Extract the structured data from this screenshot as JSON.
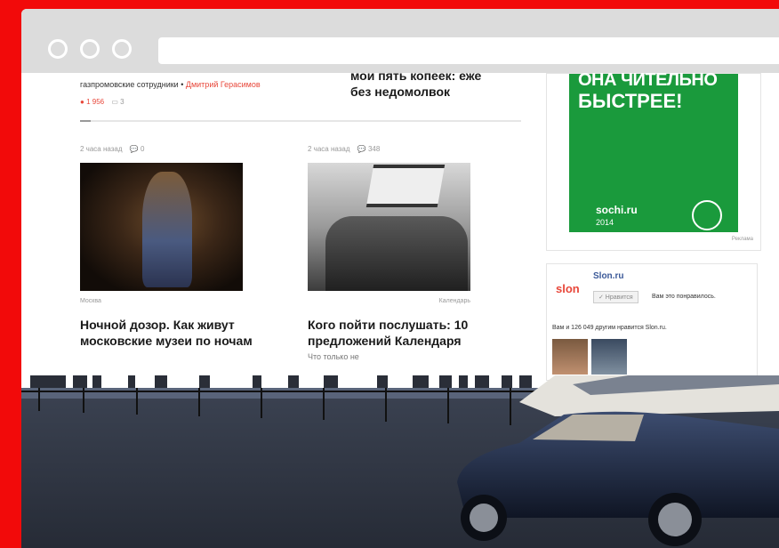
{
  "top_article_left": {
    "byline_prefix": "газпромовские сотрудники •",
    "author": "Дмитрий Герасимов",
    "views": "1 956",
    "comments": "3"
  },
  "top_article_right": {
    "headline_line1": "мои пять копеек: еже",
    "headline_line2": "без недомолвок"
  },
  "cards": [
    {
      "time": "2 часа назад",
      "comments": "0",
      "category": "Москва",
      "headline": "Ночной дозор. Как живут московские музеи по ночам"
    },
    {
      "time": "2 часа назад",
      "comments": "348",
      "category": "Календарь",
      "headline": "Кого пойти послушать: 10 предложений Календаря",
      "teaser": "Что только не"
    }
  ],
  "ad": {
    "line1": "ОНА ЧИТЕЛЬНО",
    "line2": "БЫСТРЕЕ!",
    "brand": "sochi.ru",
    "brand_sub": "2014",
    "label": "Реклама"
  },
  "social": {
    "logo": "slon",
    "title": "Slon.ru",
    "like_button": "✓ Нравится",
    "like_text": "Вам это понравилось.",
    "footer": "Вам и 126 049 другим нравится Slon.ru."
  },
  "colors": {
    "frame": "#f20a0a",
    "accent": "#e8473a",
    "ad_green": "#1a9a3c"
  }
}
